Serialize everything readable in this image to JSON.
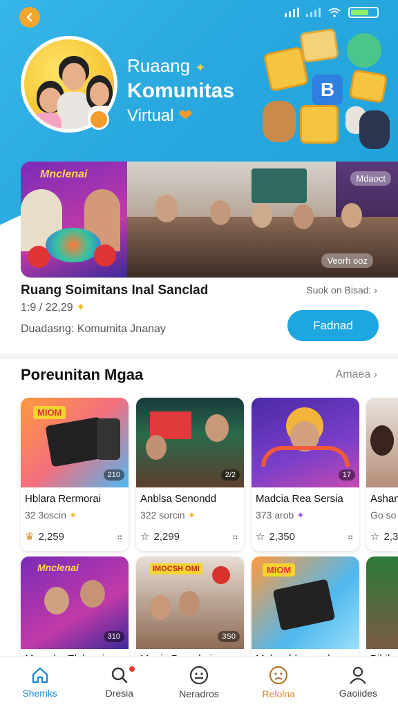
{
  "hero": {
    "title_line1": "Ruaang",
    "title_line2": "Komunitas",
    "title_line3": "Virtual"
  },
  "featured": {
    "img_tag_top": "Mdaoct",
    "img_tag_bottom": "Veorh ooz",
    "left_sign": "Mnclenai",
    "title": "Ruang Soimitans Inal Sanclad",
    "meta": "1:9 / 22,29",
    "description": "Duadasng: Komumita Jnanay",
    "link": "Suok on Bisad:",
    "button": "Fadnad"
  },
  "section": {
    "title": "Poreunitan Mgaa",
    "link": "Amaea"
  },
  "cards": [
    {
      "title": "Hblara Rermorai",
      "sub": "32 3oscin",
      "stat": "2,259",
      "badge": "210",
      "sign": "MIOM"
    },
    {
      "title": "Anblsa Senondd",
      "sub": "322 sorcin",
      "stat": "2,299",
      "badge": "2/2",
      "sign": ""
    },
    {
      "title": "Madcia Rea Sersia",
      "sub": "373 arob",
      "stat": "2,350",
      "badge": "17",
      "sign": ""
    },
    {
      "title": "Ashan",
      "sub": "Go so",
      "stat": "2,3",
      "badge": "",
      "sign": ""
    },
    {
      "title": "Mmeahs Elalnoai",
      "sub": "",
      "stat": "",
      "badge": "310",
      "sign": "Mnclenai"
    },
    {
      "title": "Maaia Bomalari",
      "sub": "",
      "stat": "",
      "badge": "3S0",
      "sign": "IMOCSH OMI"
    },
    {
      "title": "Malaw fdramrad",
      "sub": "",
      "stat": "",
      "badge": "",
      "sign": "MIOM"
    },
    {
      "title": "Bihil",
      "sub": "",
      "stat": "",
      "badge": "",
      "sign": ""
    }
  ],
  "nav": [
    {
      "label": "Shemks",
      "icon": "home-icon"
    },
    {
      "label": "Dresia",
      "icon": "search-icon"
    },
    {
      "label": "Neradros",
      "icon": "face-icon"
    },
    {
      "label": "Relolna",
      "icon": "sad-face-icon"
    },
    {
      "label": "Gaoiides",
      "icon": "user-icon"
    }
  ],
  "colors": {
    "accent": "#1ea6e0",
    "hero": "#2aa9df",
    "back": "#f4a52b",
    "nav_active": "#1e8ad6"
  }
}
